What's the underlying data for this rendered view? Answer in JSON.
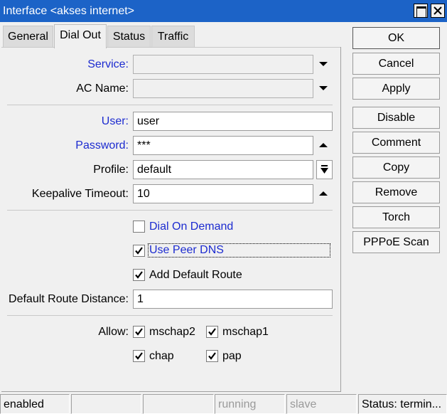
{
  "window": {
    "title": "Interface <akses internet>"
  },
  "tabs": [
    {
      "label": "General"
    },
    {
      "label": "Dial Out"
    },
    {
      "label": "Status"
    },
    {
      "label": "Traffic"
    }
  ],
  "form": {
    "service": {
      "label": "Service:",
      "value": ""
    },
    "ac_name": {
      "label": "AC Name:",
      "value": ""
    },
    "user": {
      "label": "User:",
      "value": "user"
    },
    "password": {
      "label": "Password:",
      "value": "***"
    },
    "profile": {
      "label": "Profile:",
      "value": "default"
    },
    "keepalive": {
      "label": "Keepalive Timeout:",
      "value": "10"
    },
    "dial_on_demand": {
      "label": "Dial On Demand",
      "checked": false
    },
    "use_peer_dns": {
      "label": "Use Peer DNS",
      "checked": true
    },
    "add_default_route": {
      "label": "Add Default Route",
      "checked": true
    },
    "default_route_distance": {
      "label": "Default Route Distance:",
      "value": "1"
    },
    "allow": {
      "label": "Allow:",
      "mschap2": {
        "label": "mschap2",
        "checked": true
      },
      "mschap1": {
        "label": "mschap1",
        "checked": true
      },
      "chap": {
        "label": "chap",
        "checked": true
      },
      "pap": {
        "label": "pap",
        "checked": true
      }
    }
  },
  "buttons": {
    "ok": "OK",
    "cancel": "Cancel",
    "apply": "Apply",
    "disable": "Disable",
    "comment": "Comment",
    "copy": "Copy",
    "remove": "Remove",
    "torch": "Torch",
    "pppoe_scan": "PPPoE Scan"
  },
  "status_bar": {
    "enabled": "enabled",
    "empty1": "",
    "empty2": "",
    "running": "running",
    "slave": "slave",
    "status": "Status: termin..."
  },
  "colors": {
    "titlebar": "#1c63c7",
    "link_label": "#1c2bd0"
  }
}
